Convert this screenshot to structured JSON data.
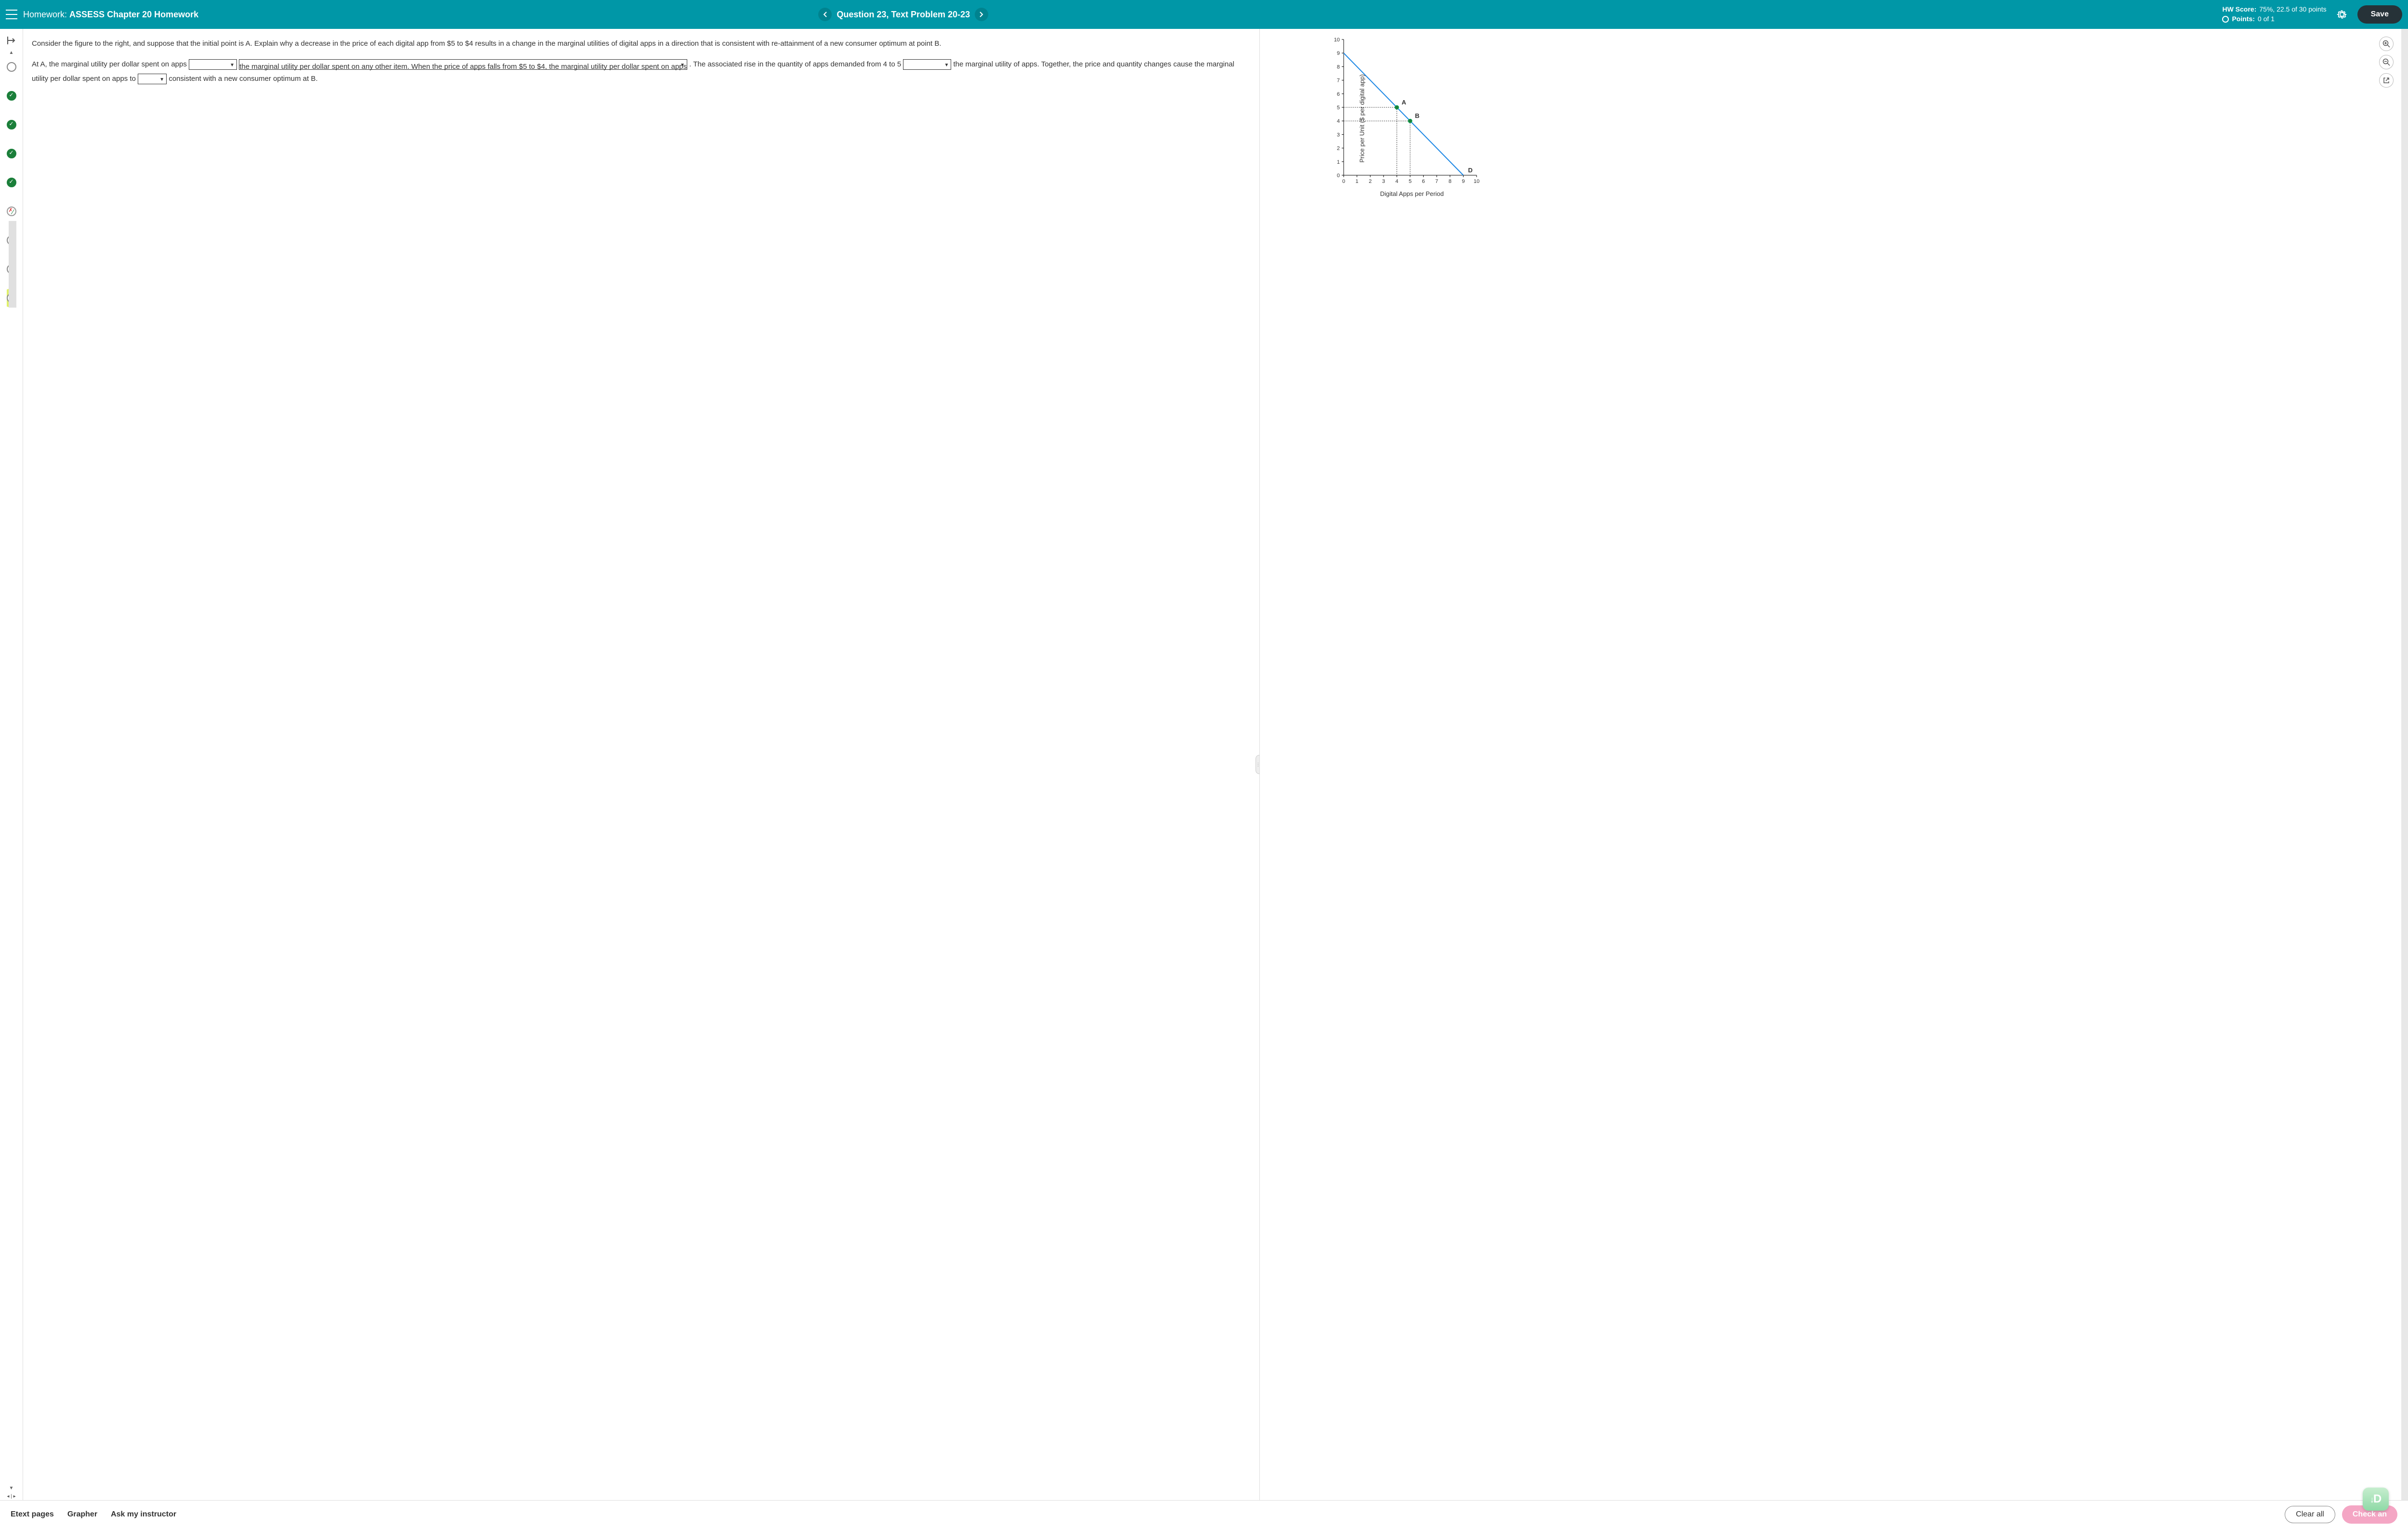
{
  "header": {
    "homework_label": "Homework:",
    "homework_name": "ASSESS Chapter 20 Homework",
    "question_label": "Question 23, Text Problem 20-23",
    "hw_score_label": "HW Score:",
    "hw_score_value": "75%, 22.5 of 30 points",
    "points_label": "Points:",
    "points_value": "0 of 1",
    "save_label": "Save"
  },
  "sidebar": {
    "items": [
      {
        "state": "unanswered"
      },
      {
        "state": "correct"
      },
      {
        "state": "correct"
      },
      {
        "state": "correct"
      },
      {
        "state": "correct"
      },
      {
        "state": "partial"
      },
      {
        "state": "unanswered"
      },
      {
        "state": "unanswered"
      },
      {
        "state": "current"
      }
    ]
  },
  "question": {
    "prompt": "Consider the figure to the right, and suppose that the initial point is A. Explain why a decrease in the price of each digital app from $5 to $4 results in a change in the marginal utilities of digital apps in a direction that is consistent with re-attainment of a new consumer optimum at point B.",
    "frag1": "At A, the marginal utility per dollar spent on apps ",
    "frag2": " the marginal utility per dollar spent on any other item. When the price of apps falls from $5 to $4, the marginal utility per dollar spent on apps ",
    "frag3": ". The associated rise in the quantity of apps demanded from 4 to 5 ",
    "frag4": " the marginal utility of apps. Together, the price and quantity changes cause the marginal utility per dollar spent on apps to ",
    "frag5": " consistent with a new consumer optimum at B."
  },
  "graph_tools": {
    "zoom_in": "⊕",
    "zoom_out": "⊖",
    "popout": "⇱"
  },
  "chart_data": {
    "type": "line",
    "title": "",
    "xlabel": "Digital Apps per Period",
    "ylabel": "Price per Unit ($ per digital app)",
    "xlim": [
      0,
      10
    ],
    "ylim": [
      0,
      10
    ],
    "xticks": [
      0,
      1,
      2,
      3,
      4,
      5,
      6,
      7,
      8,
      9,
      10
    ],
    "yticks": [
      0,
      1,
      2,
      3,
      4,
      5,
      6,
      7,
      8,
      9,
      10
    ],
    "series": [
      {
        "name": "D",
        "x": [
          0,
          9
        ],
        "y": [
          9,
          0
        ],
        "color": "#1e88e5"
      }
    ],
    "points": [
      {
        "label": "A",
        "x": 4,
        "y": 5,
        "color": "#1b7f3a"
      },
      {
        "label": "B",
        "x": 5,
        "y": 4,
        "color": "#1b7f3a"
      }
    ],
    "guides": [
      {
        "from_x": 0,
        "from_y": 5,
        "to_x": 4,
        "to_y": 5
      },
      {
        "from_x": 4,
        "from_y": 5,
        "to_x": 4,
        "to_y": 0
      },
      {
        "from_x": 0,
        "from_y": 4,
        "to_x": 5,
        "to_y": 4
      },
      {
        "from_x": 5,
        "from_y": 4,
        "to_x": 5,
        "to_y": 0
      }
    ]
  },
  "footer": {
    "etext": "Etext pages",
    "grapher": "Grapher",
    "ask": "Ask my instructor",
    "clear": "Clear all",
    "check": "Check an"
  }
}
